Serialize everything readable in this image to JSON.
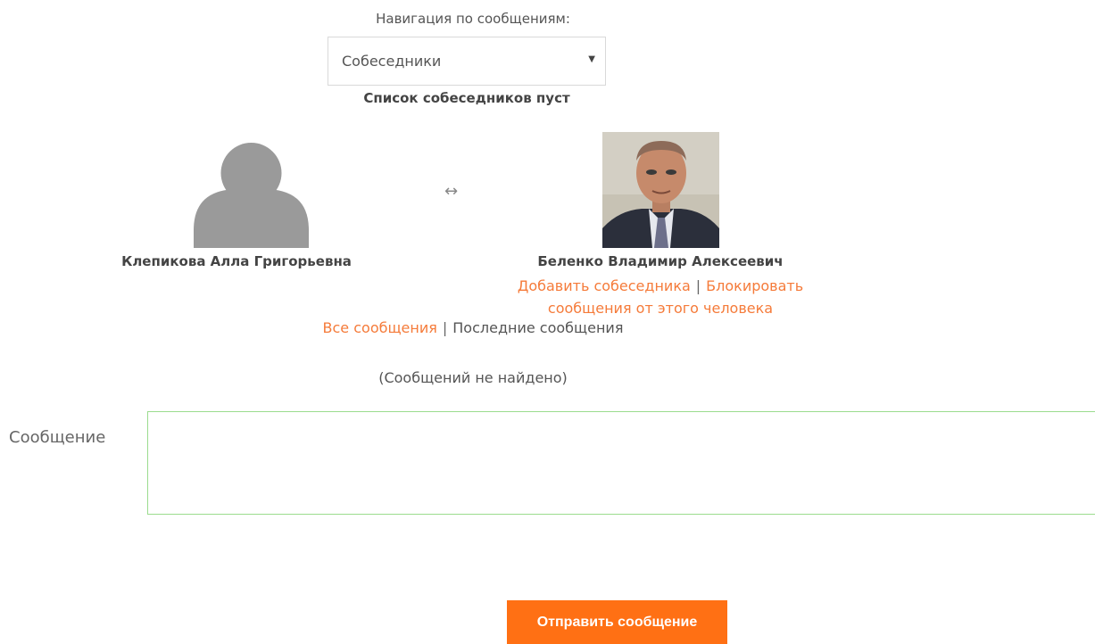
{
  "navigation": {
    "label": "Навигация по сообщениям:",
    "select_value": "Собеседники",
    "empty_contacts": "Список собеседников пуст"
  },
  "participants": {
    "me": {
      "name": "Клепикова Алла Григорьевна"
    },
    "other": {
      "name": "Беленко Владимир Алексеевич"
    },
    "swap_icon": "↔"
  },
  "contact_actions": {
    "add_contact": "Добавить собеседника",
    "separator": "|",
    "block": "Блокировать сообщения от этого человека"
  },
  "message_view": {
    "all_messages": "Все сообщения",
    "separator": "|",
    "recent_messages": "Последние сообщения",
    "no_messages": "(Сообщений не найдено)"
  },
  "composer": {
    "label": "Сообщение",
    "value": "",
    "send_label": "Отправить сообщение"
  },
  "colors": {
    "accent": "#ff7014",
    "link": "#f57b3a",
    "input_border": "#9bdc8e",
    "avatar_gray": "#9a9a9a"
  },
  "icons": [
    "default-avatar-icon",
    "swap-arrows-icon",
    "dropdown-arrow-icon"
  ]
}
